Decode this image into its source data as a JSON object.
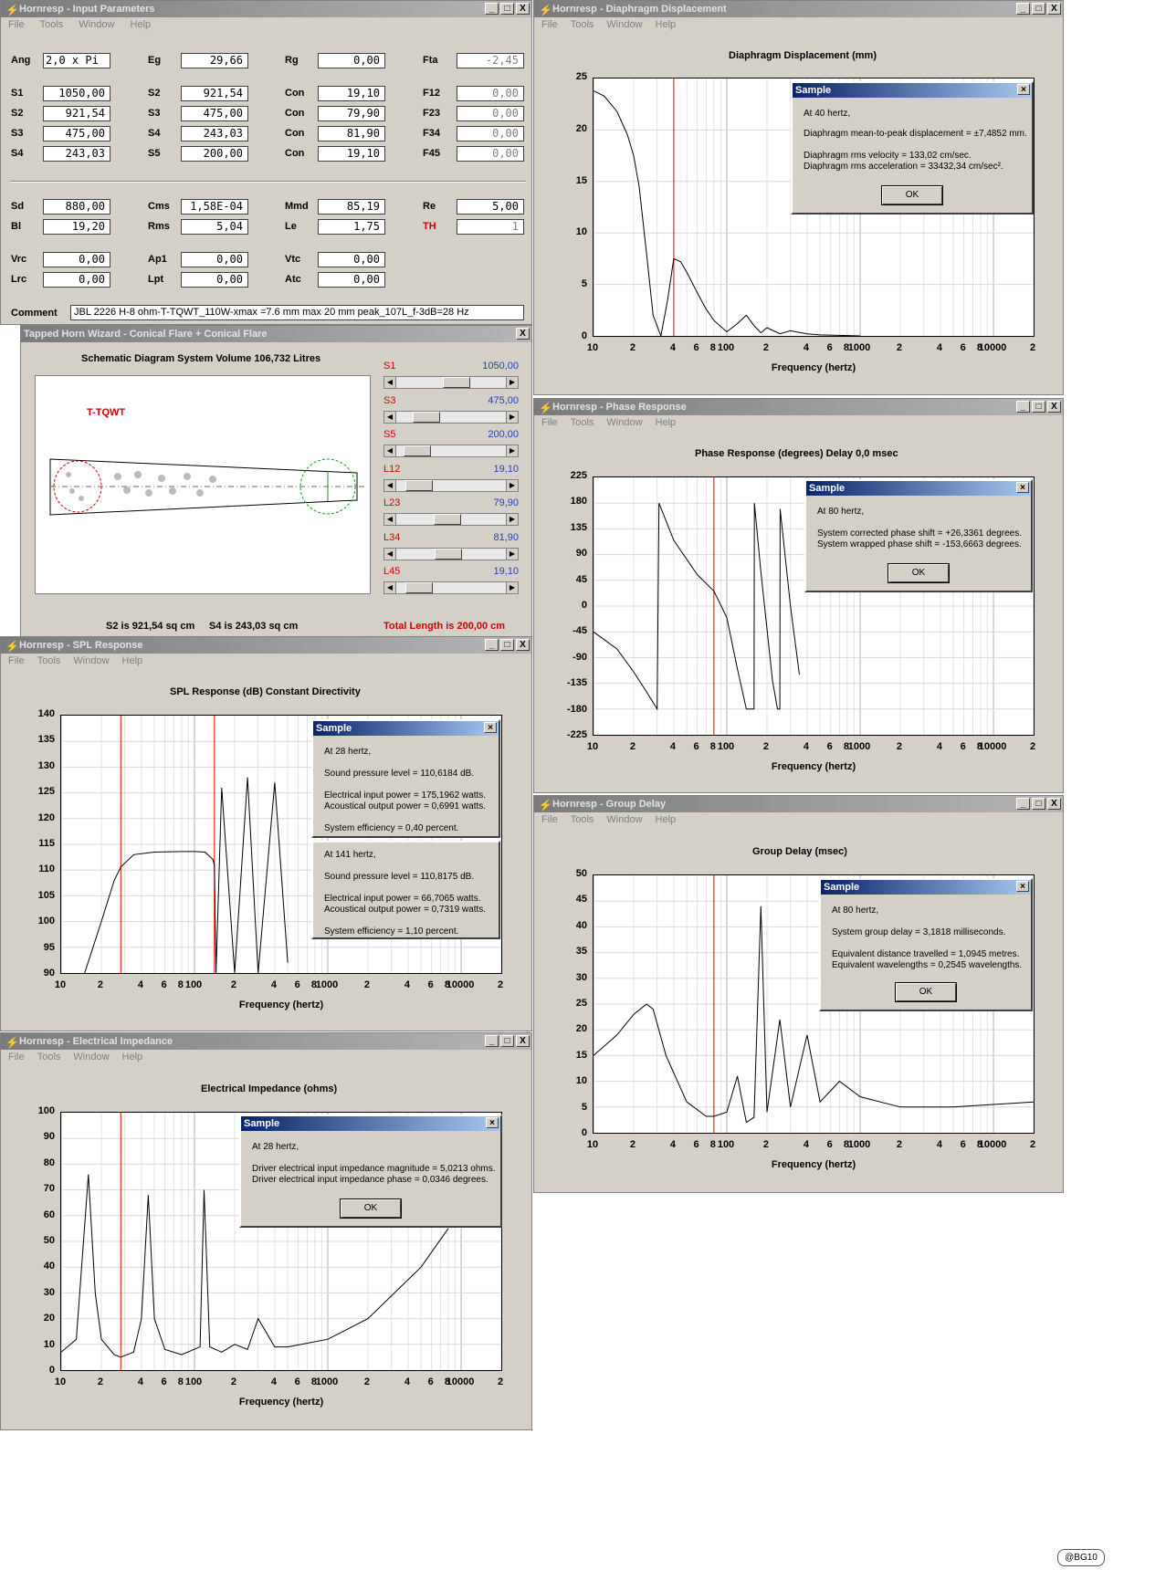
{
  "colors": {
    "marker": "#ff0000",
    "title_bar": "#8a8a8a",
    "dialog_bar": "#0a246a",
    "label_red": "#cc0000",
    "value_blue": "#2040c0"
  },
  "menu": [
    "File",
    "Tools",
    "Window",
    "Help"
  ],
  "title_buttons": [
    "_",
    "□",
    "X"
  ],
  "input": {
    "title": "Hornresp - Input Parameters",
    "rows": [
      [
        {
          "l": "Ang",
          "v": "2,0 x Pi"
        },
        {
          "l": "Eg",
          "v": "29,66"
        },
        {
          "l": "Rg",
          "v": "0,00"
        },
        {
          "l": "Fta",
          "v": "-2,45",
          "dis": true
        }
      ],
      [
        {
          "l": "S1",
          "v": "1050,00"
        },
        {
          "l": "S2",
          "v": "921,54"
        },
        {
          "l": "Con",
          "v": "19,10"
        },
        {
          "l": "F12",
          "v": "0,00",
          "dis": true
        }
      ],
      [
        {
          "l": "S2",
          "v": "921,54"
        },
        {
          "l": "S3",
          "v": "475,00"
        },
        {
          "l": "Con",
          "v": "79,90"
        },
        {
          "l": "F23",
          "v": "0,00",
          "dis": true
        }
      ],
      [
        {
          "l": "S3",
          "v": "475,00"
        },
        {
          "l": "S4",
          "v": "243,03"
        },
        {
          "l": "Con",
          "v": "81,90"
        },
        {
          "l": "F34",
          "v": "0,00",
          "dis": true
        }
      ],
      [
        {
          "l": "S4",
          "v": "243,03"
        },
        {
          "l": "S5",
          "v": "200,00"
        },
        {
          "l": "Con",
          "v": "19,10"
        },
        {
          "l": "F45",
          "v": "0,00",
          "dis": true
        }
      ],
      [
        {
          "l": "Sd",
          "v": "880,00"
        },
        {
          "l": "Cms",
          "v": "1,58E-04"
        },
        {
          "l": "Mmd",
          "v": "85,19"
        },
        {
          "l": "Re",
          "v": "5,00"
        }
      ],
      [
        {
          "l": "Bl",
          "v": "19,20"
        },
        {
          "l": "Rms",
          "v": "5,04"
        },
        {
          "l": "Le",
          "v": "1,75"
        },
        {
          "l": "TH",
          "v": "1",
          "dis": true,
          "red": true
        }
      ],
      [
        {
          "l": "Vrc",
          "v": "0,00"
        },
        {
          "l": "Ap1",
          "v": "0,00"
        },
        {
          "l": "Vtc",
          "v": "0,00"
        }
      ],
      [
        {
          "l": "Lrc",
          "v": "0,00"
        },
        {
          "l": "Lpt",
          "v": "0,00"
        },
        {
          "l": "Atc",
          "v": "0,00"
        }
      ]
    ],
    "comment_label": "Comment",
    "comment": "JBL 2226 H-8 ohm-T-TQWT_110W-xmax =7.6 mm  max 20 mm peak_107L_f-3dB=28 Hz"
  },
  "wizard": {
    "title": "Tapped Horn Wizard - Conical Flare + Conical Flare",
    "heading": "Schematic Diagram   System Volume 106,732 Litres",
    "tag": "T-TQWT",
    "sliders": [
      {
        "label": "S1",
        "value": "1050,00",
        "pos": 0.55
      },
      {
        "label": "S3",
        "value": "475,00",
        "pos": 0.2
      },
      {
        "label": "S5",
        "value": "200,00",
        "pos": 0.1
      },
      {
        "label": "L12",
        "value": "19,10",
        "pos": 0.12
      },
      {
        "label": "L23",
        "value": "79,90",
        "pos": 0.45
      },
      {
        "label": "L34",
        "value": "81,90",
        "pos": 0.46
      },
      {
        "label": "L45",
        "value": "19,10",
        "pos": 0.12
      }
    ],
    "s2": "S2 is 921,54 sq cm",
    "s4": "S4 is 243,03 sq cm",
    "total": "Total Length is 200,00 cm"
  },
  "x_ticks": [
    "10",
    "2",
    "4",
    "6",
    "8",
    "100",
    "2",
    "4",
    "6",
    "8",
    "1000",
    "2",
    "4",
    "6",
    "8",
    "10000",
    "2"
  ],
  "x_label": "Frequency (hertz)",
  "charts": {
    "displacement": {
      "title": "Hornresp - Diaphragm Displacement",
      "chart_title": "Diaphragm Displacement (mm)",
      "y_ticks": [
        "25",
        "20",
        "15",
        "10",
        "5",
        "0"
      ],
      "dialog": {
        "title": "Sample",
        "lines": [
          "At 40 hertz,",
          "Diaphragm mean-to-peak displacement = ±7,4852 mm.",
          "Diaphragm rms velocity = 133,02 cm/sec.",
          "Diaphragm rms acceleration = 33432,34 cm/sec²."
        ],
        "ok": "OK"
      }
    },
    "phase": {
      "title": "Hornresp - Phase Response",
      "chart_title": "Phase Response (degrees)   Delay 0,0 msec",
      "y_ticks": [
        "225",
        "180",
        "135",
        "90",
        "45",
        "0",
        "-45",
        "-90",
        "-135",
        "-180",
        "-225"
      ],
      "dialog": {
        "title": "Sample",
        "lines": [
          "At 80 hertz,",
          "System corrected phase shift = +26,3361 degrees.",
          "System wrapped phase shift = -153,6663 degrees."
        ],
        "ok": "OK"
      }
    },
    "spl": {
      "title": "Hornresp - SPL Response",
      "chart_title": "SPL Response (dB)   Constant Directivity",
      "y_ticks": [
        "140",
        "135",
        "130",
        "125",
        "120",
        "115",
        "110",
        "105",
        "100",
        "95",
        "90"
      ],
      "dialog1": {
        "title": "Sample",
        "lines": [
          "At 28 hertz,",
          "Sound pressure level = 110,6184 dB.",
          "Electrical input power = 175,1962 watts.",
          "Acoustical output power = 0,6991 watts.",
          "System efficiency = 0,40 percent."
        ]
      },
      "dialog2": {
        "lines": [
          "At 141 hertz,",
          "Sound pressure level = 110,8175 dB.",
          "Electrical input power = 66,7065 watts.",
          "Acoustical output power = 0,7319 watts.",
          "System efficiency = 1,10 percent."
        ]
      }
    },
    "group": {
      "title": "Hornresp - Group Delay",
      "chart_title": "Group Delay (msec)",
      "y_ticks": [
        "50",
        "45",
        "40",
        "35",
        "30",
        "25",
        "20",
        "15",
        "10",
        "5",
        "0"
      ],
      "dialog": {
        "title": "Sample",
        "lines": [
          "At 80 hertz,",
          "System group delay = 3,1818 milliseconds.",
          "Equivalent distance travelled = 1,0945 metres.",
          "Equivalent wavelengths = 0,2545 wavelengths."
        ],
        "ok": "OK"
      }
    },
    "impedance": {
      "title": "Hornresp - Electrical Impedance",
      "chart_title": "Electrical Impedance (ohms)",
      "y_ticks": [
        "100",
        "90",
        "80",
        "70",
        "60",
        "50",
        "40",
        "30",
        "20",
        "10",
        "0"
      ],
      "dialog": {
        "title": "Sample",
        "lines": [
          "At 28 hertz,",
          "Driver electrical input impedance magnitude = 5,0213 ohms.",
          "Driver electrical input impedance phase = 0,0346 degrees."
        ],
        "ok": "OK"
      }
    }
  },
  "chart_data": [
    {
      "type": "line",
      "title": "Diaphragm Displacement (mm)",
      "xlabel": "Frequency (hertz)",
      "x_scale": "log",
      "xlim": [
        10,
        20000
      ],
      "ylim": [
        0,
        25
      ],
      "series": [
        {
          "x": [
            10,
            12,
            15,
            18,
            20,
            22,
            25,
            28,
            32,
            36,
            40,
            45,
            50,
            60,
            70,
            80,
            100,
            120,
            140,
            160,
            180,
            200,
            250,
            300,
            400,
            500,
            700,
            1000
          ],
          "values": [
            23.8,
            23.3,
            21.8,
            19.5,
            17.5,
            14.5,
            8,
            2,
            0,
            3.5,
            7.5,
            7.2,
            6.2,
            4.2,
            2.6,
            1.5,
            0.4,
            1.2,
            2,
            1,
            0.3,
            0.8,
            0.2,
            0.5,
            0.2,
            0.1,
            0.05,
            0
          ]
        }
      ],
      "markers_x": [
        40
      ]
    },
    {
      "type": "line",
      "title": "Phase Response (degrees)",
      "xlabel": "Frequency (hertz)",
      "x_scale": "log",
      "xlim": [
        10,
        20000
      ],
      "ylim": [
        -225,
        225
      ],
      "series": [
        {
          "x": [
            10,
            15,
            20,
            25,
            30,
            31,
            40,
            60,
            80,
            100,
            120,
            140,
            160,
            161,
            180,
            200,
            220,
            240,
            250,
            251,
            300,
            350
          ],
          "values": [
            -45,
            -75,
            -115,
            -150,
            -180,
            180,
            115,
            55,
            26,
            -20,
            -110,
            -180,
            -180,
            180,
            60,
            -40,
            -130,
            -180,
            -180,
            170,
            0,
            -120
          ]
        }
      ],
      "markers_x": [
        80
      ]
    },
    {
      "type": "line",
      "title": "SPL Response (dB)",
      "xlabel": "Frequency (hertz)",
      "x_scale": "log",
      "xlim": [
        10,
        20000
      ],
      "ylim": [
        90,
        140
      ],
      "series": [
        {
          "x": [
            15,
            20,
            25,
            28,
            35,
            50,
            80,
            100,
            120,
            138,
            141,
            145,
            160,
            200,
            250,
            300,
            400,
            500
          ],
          "values": [
            90,
            100,
            108,
            110.6,
            113,
            113.5,
            113.6,
            113.6,
            113.5,
            112,
            110.8,
            90,
            126,
            90,
            128,
            90,
            127,
            92
          ]
        }
      ],
      "markers_x": [
        28,
        141
      ]
    },
    {
      "type": "line",
      "title": "Group Delay (msec)",
      "xlabel": "Frequency (hertz)",
      "x_scale": "log",
      "xlim": [
        10,
        20000
      ],
      "ylim": [
        0,
        50
      ],
      "series": [
        {
          "x": [
            10,
            15,
            20,
            25,
            28,
            35,
            50,
            70,
            80,
            100,
            120,
            140,
            160,
            180,
            200,
            250,
            300,
            400,
            500,
            700,
            1000,
            2000,
            5000,
            20000
          ],
          "values": [
            15,
            19,
            23,
            25,
            24,
            15,
            6,
            3.2,
            3.2,
            4,
            11,
            2,
            3,
            44,
            4,
            22,
            5,
            19,
            6,
            10,
            7,
            5,
            5,
            6
          ]
        }
      ],
      "markers_x": [
        80
      ]
    },
    {
      "type": "line",
      "title": "Electrical Impedance (ohms)",
      "xlabel": "Frequency (hertz)",
      "x_scale": "log",
      "xlim": [
        10,
        20000
      ],
      "ylim": [
        0,
        100
      ],
      "series": [
        {
          "x": [
            10,
            13,
            16,
            18,
            20,
            25,
            28,
            35,
            40,
            45,
            50,
            60,
            80,
            110,
            118,
            130,
            160,
            200,
            250,
            300,
            400,
            500,
            1000,
            2000,
            5000,
            8000
          ],
          "values": [
            7,
            12,
            76,
            30,
            12,
            6,
            5,
            7,
            20,
            68,
            20,
            8,
            6,
            9,
            70,
            9,
            7,
            10,
            8,
            20,
            9,
            9,
            12,
            20,
            40,
            55
          ]
        }
      ],
      "markers_x": [
        28
      ]
    }
  ],
  "watermark": "@BG10"
}
